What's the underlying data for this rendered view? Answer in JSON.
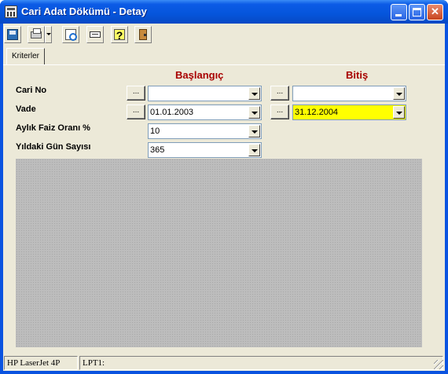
{
  "window": {
    "title": "Cari Adat Dökümü - Detay",
    "close_glyph": "✕"
  },
  "toolbar": {
    "help_glyph": "?",
    "icons": [
      "save-icon",
      "print-icon",
      "print-preview-icon",
      "printer-setup-icon",
      "help-icon",
      "exit-icon"
    ]
  },
  "tabs": [
    {
      "label": "Kriterler"
    }
  ],
  "form": {
    "start_header": "Başlangıç",
    "end_header": "Bitiş",
    "dots_label": "...",
    "rows": {
      "cari_no": {
        "label": "Cari No",
        "start_value": "",
        "end_value": ""
      },
      "vade": {
        "label": "Vade",
        "start_value": "01.01.2003",
        "end_value": "31.12.2004"
      },
      "faiz": {
        "label": "Aylık Faiz Oranı %",
        "value": "10"
      },
      "gun": {
        "label": "Yıldaki Gün Sayısı",
        "value": "365"
      }
    }
  },
  "statusbar": {
    "printer": "HP LaserJet 4P",
    "port": "LPT1:"
  },
  "colors": {
    "title_bar": "#0555DB",
    "header_text": "#A80000",
    "highlight_field": "#FFFF00",
    "panel_gray": "#BDBDBD"
  }
}
